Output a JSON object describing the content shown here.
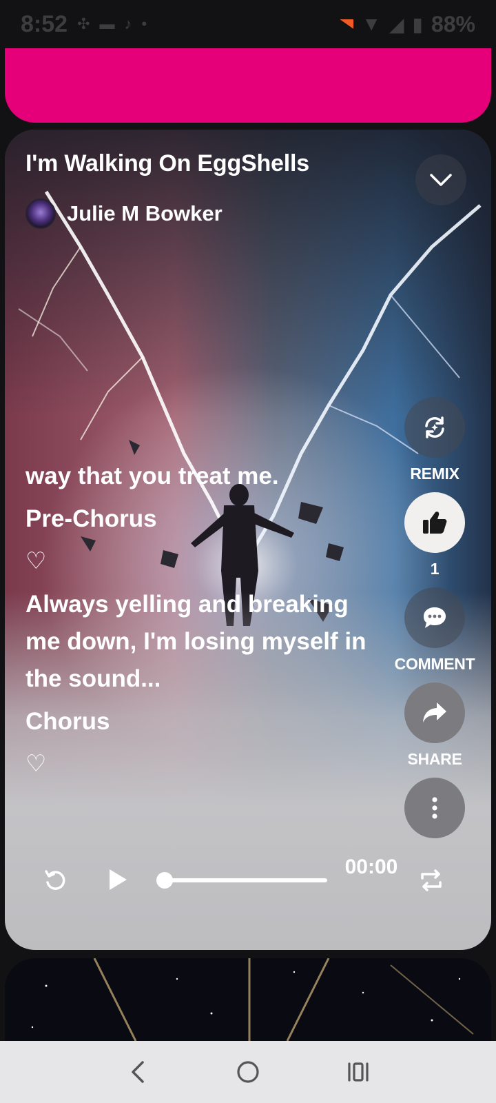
{
  "status_bar": {
    "time": "8:52",
    "battery": "88%",
    "icons": [
      "fan-icon",
      "messages-icon",
      "tiktok-icon",
      "dot-icon",
      "notification-icon",
      "wifi-icon",
      "signal-icon",
      "battery-icon"
    ]
  },
  "song": {
    "title": "I'm Walking On EggShells",
    "artist": "Julie M Bowker"
  },
  "lyrics": {
    "line1": "way that you treat me.",
    "section1": "Pre-Chorus",
    "heart1": "♡",
    "line2": "Always yelling and breaking me down, I'm losing myself in the sound...",
    "section2": "Chorus",
    "heart2": "♡"
  },
  "actions": {
    "remix_label": "REMIX",
    "like_count": "1",
    "comment_label": "COMMENT",
    "share_label": "SHARE"
  },
  "player": {
    "time": "00:00",
    "progress": 0
  },
  "colors": {
    "accent_pink": "#e5007a",
    "background": "#121214",
    "nav_bar": "#e6e6e8"
  }
}
